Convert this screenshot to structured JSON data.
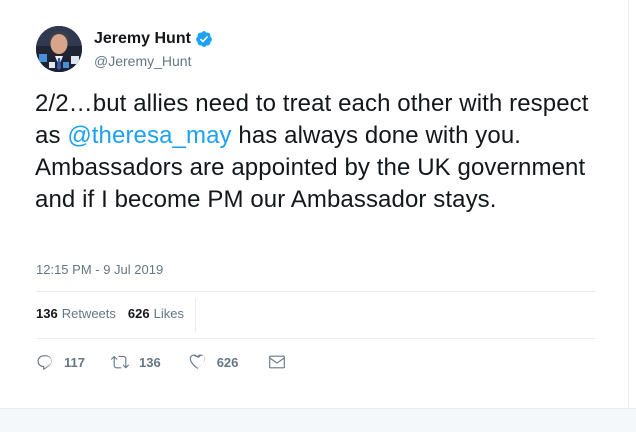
{
  "author": {
    "display_name": "Jeremy Hunt",
    "handle": "@Jeremy_Hunt",
    "verified": true,
    "avatar_icon": "profile-photo"
  },
  "tweet": {
    "text_before_mention": "2/2…but allies need to treat each other with respect as ",
    "mention": "@theresa_may",
    "text_after_mention": " has always done with you. Ambassadors are appointed by the UK government and if I become PM our Ambassador stays.",
    "timestamp": "12:15 PM - 9 Jul 2019"
  },
  "stats": {
    "retweets_count": "136",
    "retweets_label": "Retweets",
    "likes_count": "626",
    "likes_label": "Likes"
  },
  "actions": {
    "reply_count": "117",
    "retweet_count": "136",
    "like_count": "626",
    "icons": [
      "reply-icon",
      "retweet-icon",
      "like-icon",
      "direct-message-icon"
    ]
  },
  "colors": {
    "mention": "#1da1f2",
    "verified_badge": "#1da1f2",
    "text_primary": "#14171a",
    "text_secondary": "#657786",
    "divider": "#e6ecf0"
  }
}
